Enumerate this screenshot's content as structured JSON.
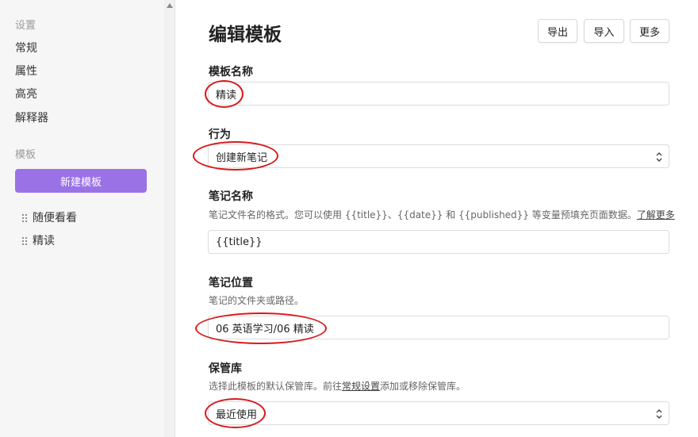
{
  "sidebar": {
    "settings_heading": "设置",
    "items": [
      {
        "label": "常规"
      },
      {
        "label": "属性"
      },
      {
        "label": "高亮"
      },
      {
        "label": "解释器"
      }
    ],
    "templates_heading": "模板",
    "new_template_label": "新建模板",
    "templates": [
      {
        "label": "随便看看"
      },
      {
        "label": "精读"
      }
    ],
    "accent_color": "#9b72e6"
  },
  "header": {
    "title": "编辑模板",
    "export_label": "导出",
    "import_label": "导入",
    "more_label": "更多"
  },
  "form": {
    "template_name": {
      "label": "模板名称",
      "value": "精读"
    },
    "behavior": {
      "label": "行为",
      "value": "创建新笔记"
    },
    "note_name": {
      "label": "笔记名称",
      "desc_prefix": "笔记文件名的格式。您可以使用 {{title}}、{{date}} 和 {{published}} 等变量预填充页面数据。",
      "desc_link": "了解更多",
      "value": "{{title}}"
    },
    "note_location": {
      "label": "笔记位置",
      "desc": "笔记的文件夹或路径。",
      "value": "06 英语学习/06 精读"
    },
    "vault": {
      "label": "保管库",
      "desc_prefix": "选择此模板的默认保管库。前往",
      "desc_link": "常规设置",
      "desc_suffix": "添加或移除保管库。",
      "value": "最近使用"
    }
  },
  "annotation_color": "#d8191b"
}
